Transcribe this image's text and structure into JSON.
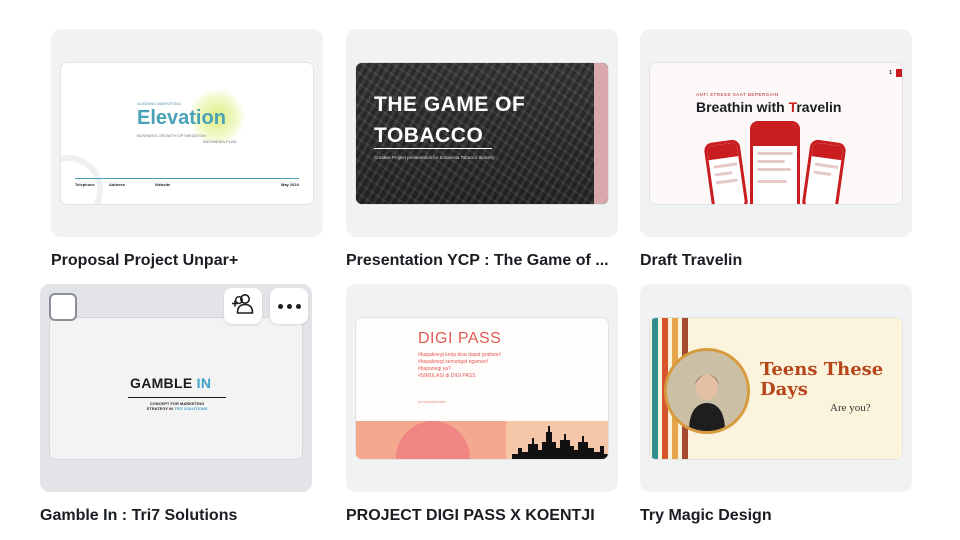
{
  "cards": [
    {
      "title": "Proposal Project Unpar+",
      "thumb": {
        "tagline": "ALIGNING MARKETING",
        "heading": "Elevation",
        "subheading": "BUSINESS GROWTH OPTIMIZATION",
        "subheading2": "INDONESIA PLAN",
        "footer_cols": [
          "Telephone",
          "Address",
          "Website"
        ],
        "date": "May 2024"
      }
    },
    {
      "title": "Presentation YCP : The Game of ...",
      "thumb": {
        "heading_line1": "THE GAME OF",
        "heading_line2": "TOBACCO",
        "subtitle": "Creative Project presentation for Indonesia Tobacco Industry"
      }
    },
    {
      "title": "Draft  Travelin",
      "thumb": {
        "tagline": "ANTI STRESS SAAT BEPERGIAN",
        "heading_a": "Breathin with ",
        "heading_hl": "T",
        "heading_b": "ravelin",
        "page": "1"
      }
    },
    {
      "title": "Gamble In : Tri7 Solutions",
      "hovered": true,
      "thumb": {
        "heading_a": "GAMBLE ",
        "heading_hl": "IN",
        "sub_line1": "CONCEPT FOR MARKETING",
        "sub_line2_a": "STRATEGY IN ",
        "sub_line2_hl": "TRI7 SOLUTIONS"
      }
    },
    {
      "title": "PROJECT DIGI PASS X KOENTJI",
      "thumb": {
        "heading": "DIGI PASS",
        "hashtags": [
          "#bapaknegi kerja bisa dapat gratisan!",
          "#bapaknegi semangat ngamen!",
          "#bapanegi ya?",
          "#SIMULASI di DIGI PASS"
        ],
        "footnote": "presentasi kami"
      }
    },
    {
      "title": "Try Magic Design",
      "thumb": {
        "heading": "Teens These Days",
        "subtitle": "Are you?"
      }
    }
  ],
  "icons": {
    "checkbox": "select-checkbox",
    "share": "share-people-icon",
    "more": "more-options-icon"
  },
  "colors": {
    "card_bg": "#f1f2f4",
    "card_bg_hover": "#e2e4e8",
    "text": "#1a1d21"
  }
}
